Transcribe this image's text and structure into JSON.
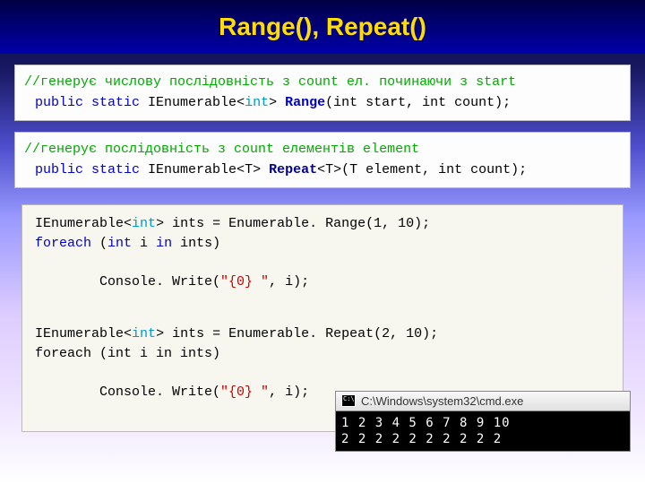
{
  "title": "Range(), Repeat()",
  "sig1": {
    "comment": "//генерує числову послідовність з count ел. починаючи з start",
    "line": {
      "pre": "public static ",
      "ienum": "IEnumerable",
      "lt": "<",
      "int": "int",
      "gt": "> ",
      "method": "Range",
      "post": "(int start, int count);"
    }
  },
  "sig2": {
    "comment": "//генерує послідовність з count елементів element",
    "line": {
      "pre": "public static ",
      "ienum": "IEnumerable",
      "lt": "<T> ",
      "method": "Repeat",
      "post": "<T>(T element, int count);"
    }
  },
  "code": {
    "l1": {
      "a": "IEnumerable",
      "b": "<",
      "c": "int",
      "d": "> ints = Enumerable. Range(1, 10);"
    },
    "l2": {
      "a": "foreach",
      "b": " (",
      "c": "int",
      "d": " i ",
      "e": "in",
      "f": " ints)"
    },
    "l3": {
      "a": "    Console. Write(",
      "b": "\"{0} \"",
      "c": ", i);"
    },
    "l4": {
      "a": "IEnumerable",
      "b": "<",
      "c": "int",
      "d": "> ints = Enumerable. Repeat(2, 10);"
    },
    "l5": {
      "a": "foreach (int i in ints)"
    },
    "l6": {
      "a": "    Console. Write(",
      "b": "\"{0} \"",
      "c": ", i);"
    }
  },
  "console": {
    "path": "C:\\Windows\\system32\\cmd.exe",
    "out1": "1 2 3 4 5 6 7 8 9 10",
    "out2": "2 2 2 2 2 2 2 2 2 2"
  }
}
